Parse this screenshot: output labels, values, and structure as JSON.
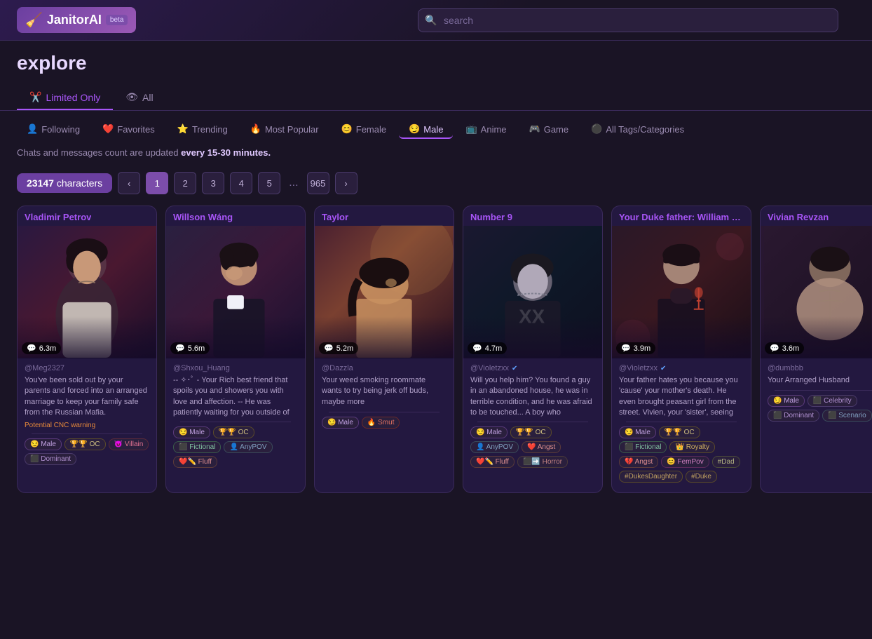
{
  "app": {
    "name": "JanitorAI",
    "beta": "beta",
    "logo_icon": "🧹"
  },
  "search": {
    "placeholder": "search"
  },
  "page": {
    "title": "explore"
  },
  "filter_tabs": [
    {
      "id": "limited",
      "label": "Limited Only",
      "icon": "✂️",
      "active": true
    },
    {
      "id": "all",
      "label": "All",
      "icon": "👁",
      "active": false
    }
  ],
  "category_tabs": [
    {
      "id": "following",
      "label": "Following",
      "icon": "👤",
      "active": false
    },
    {
      "id": "favorites",
      "label": "Favorites",
      "icon": "❤️",
      "active": false
    },
    {
      "id": "trending",
      "label": "Trending",
      "icon": "⭐",
      "active": false
    },
    {
      "id": "mostpopular",
      "label": "Most Popular",
      "icon": "🔥",
      "active": false
    },
    {
      "id": "female",
      "label": "Female",
      "icon": "😊",
      "active": false
    },
    {
      "id": "male",
      "label": "Male",
      "icon": "😏",
      "active": true
    },
    {
      "id": "anime",
      "label": "Anime",
      "icon": "📺",
      "active": false
    },
    {
      "id": "game",
      "label": "Game",
      "icon": "🎮",
      "active": false
    },
    {
      "id": "alltags",
      "label": "All Tags/Categories",
      "icon": "⚫",
      "active": false
    }
  ],
  "notice": {
    "text": "Chats and messages count are updated ",
    "highlight": "every 15-30 minutes."
  },
  "pagination": {
    "char_count": "23147",
    "char_label": "characters",
    "pages": [
      "1",
      "2",
      "3",
      "4",
      "5",
      "...",
      "965"
    ],
    "current": "1"
  },
  "cards": [
    {
      "name": "Vladimir Petrov",
      "author": "@Meg2327",
      "chat_count": "6.3m",
      "description": "You've been sold out by your parents and forced into an arranged marriage to keep your family safe from the Russian Mafia.",
      "warning": "Potential CNC warning",
      "tags": [
        {
          "label": "Male",
          "icon": "😏",
          "type": "male"
        },
        {
          "label": "OC",
          "icon": "🏆🏆",
          "type": "oc"
        },
        {
          "label": "Villain",
          "icon": "😈",
          "type": "villain"
        },
        {
          "label": "Dominant",
          "icon": "⬛",
          "type": "dominant"
        }
      ],
      "bg_color": "#1a0e2a",
      "gradient": "linear-gradient(160deg, #2a1840 0%, #4a1830 50%, #1a0e2a 100%)"
    },
    {
      "name": "Willson Wáng",
      "author": "@Shxou_Huang",
      "chat_count": "5.6m",
      "description": "-- ✧･ﾟ - Your Rich best friend that spoils you and showers you with love and affection. -- He was patiently waiting for you outside of the school gate while you end u...",
      "warning": "",
      "tags": [
        {
          "label": "Male",
          "icon": "😏",
          "type": "male"
        },
        {
          "label": "OC",
          "icon": "🏆🏆",
          "type": "oc"
        },
        {
          "label": "Fictional",
          "icon": "⬛",
          "type": "fictional"
        },
        {
          "label": "AnyPOV",
          "icon": "👤",
          "type": "anypov"
        },
        {
          "label": "Fluff",
          "icon": "❤️✏️",
          "type": "fluff"
        }
      ],
      "bg_color": "#1a1030",
      "gradient": "linear-gradient(160deg, #2a2040 0%, #3a1838 50%, #1a1030 100%)"
    },
    {
      "name": "Taylor",
      "author": "@Dazzla",
      "chat_count": "5.2m",
      "description": "Your weed smoking roommate wants to try being jerk off buds, maybe more",
      "warning": "",
      "tags": [
        {
          "label": "Male",
          "icon": "😏",
          "type": "male"
        },
        {
          "label": "Smut",
          "icon": "🔥",
          "type": "smut"
        }
      ],
      "bg_color": "#1e1020",
      "gradient": "linear-gradient(160deg, #3a2030 0%, #5a2828 50%, #1e1020 100%)"
    },
    {
      "name": "Number 9",
      "author": "@Violetzxx",
      "author_verified": true,
      "chat_count": "4.7m",
      "description": "Will you help him? You found a guy in an abandoned house, he was in terrible condition, and he was afraid to be touched... A boy who experienced so much violence that he...",
      "warning": "",
      "tags": [
        {
          "label": "Male",
          "icon": "😏",
          "type": "male"
        },
        {
          "label": "OC",
          "icon": "🏆🏆",
          "type": "oc"
        },
        {
          "label": "AnyPOV",
          "icon": "👤",
          "type": "anypov"
        },
        {
          "label": "Angst",
          "icon": "❤️",
          "type": "angst"
        },
        {
          "label": "Fluff",
          "icon": "❤️✏️",
          "type": "fluff"
        },
        {
          "label": "Horror",
          "icon": "⬛➡️",
          "type": "horror"
        }
      ],
      "bg_color": "#0e1020",
      "gradient": "linear-gradient(160deg, #1a1830 0%, #0e1828 50%, #0e1020 100%)"
    },
    {
      "name": "Your Duke father: William Van",
      "author": "@Violetzxx",
      "author_verified": true,
      "chat_count": "3.9m",
      "description": "Your father hates you because you 'cause' your mother's death. He even brought peasant girl from the street. Vivien, your 'sister', seeing that your father doesn't love ...",
      "warning": "",
      "tags": [
        {
          "label": "Male",
          "icon": "😏",
          "type": "male"
        },
        {
          "label": "OC",
          "icon": "🏆🏆",
          "type": "oc"
        },
        {
          "label": "Fictional",
          "icon": "⬛",
          "type": "fictional"
        },
        {
          "label": "Royalty",
          "icon": "👑",
          "type": "royalty"
        },
        {
          "label": "Angst",
          "icon": "💔",
          "type": "angst"
        },
        {
          "label": "FemPov",
          "icon": "😊",
          "type": "fempov"
        },
        {
          "label": "#Dad",
          "icon": "",
          "type": "dad"
        },
        {
          "label": "#DukesDaughter",
          "icon": "",
          "type": "dukesdaughter"
        },
        {
          "label": "#Duke",
          "icon": "",
          "type": "duke"
        }
      ],
      "bg_color": "#1a0e18",
      "gradient": "linear-gradient(160deg, #2a1828 0%, #3a1820 50%, #1a0e18 100%)"
    },
    {
      "name": "Vivian Revzan",
      "author": "@dumbbb",
      "chat_count": "3.6m",
      "description": "Your Arranged Husband",
      "warning": "",
      "tags": [
        {
          "label": "Male",
          "icon": "😏",
          "type": "male"
        },
        {
          "label": "Celebrity",
          "icon": "⬛",
          "type": "celebrity"
        },
        {
          "label": "Dominant",
          "icon": "⬛",
          "type": "dominant"
        },
        {
          "label": "Scenario",
          "icon": "⬛",
          "type": "scenario"
        }
      ],
      "bg_color": "#1a1020",
      "gradient": "linear-gradient(160deg, #2a1830 0%, #1a1020 100%)"
    }
  ]
}
